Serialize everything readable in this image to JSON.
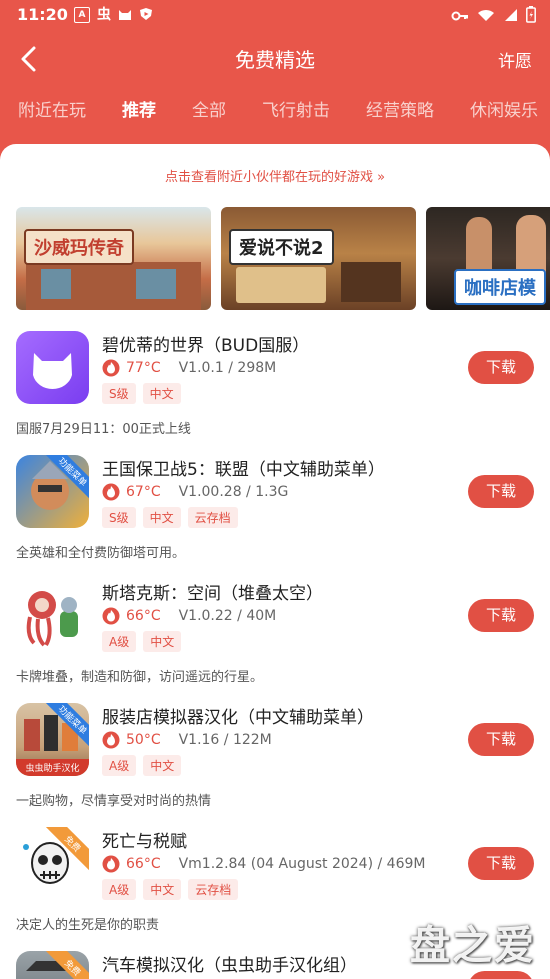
{
  "status": {
    "time": "11:20",
    "icons": [
      "A",
      "虫",
      "🐱",
      "▶"
    ],
    "right_icons": [
      "key-icon",
      "wifi-icon",
      "signal-icon",
      "battery-icon"
    ]
  },
  "header": {
    "title": "免费精选",
    "right_action": "许愿"
  },
  "tabs": [
    {
      "label": "附近在玩",
      "active": false
    },
    {
      "label": "推荐",
      "active": true
    },
    {
      "label": "全部",
      "active": false
    },
    {
      "label": "飞行射击",
      "active": false
    },
    {
      "label": "经营策略",
      "active": false
    },
    {
      "label": "休闲娱乐",
      "active": false
    }
  ],
  "notice": "点击查看附近小伙伴都在玩的好游戏 »",
  "banners": [
    {
      "label": "沙威玛传奇"
    },
    {
      "label": "爱说不说2"
    },
    {
      "label": "咖啡店模"
    }
  ],
  "download_label": "下载",
  "games": [
    {
      "name": "碧优蒂的世界（BUD国服）",
      "temp": "77°C",
      "version": "V1.0.1 / 298M",
      "tags": [
        "S级",
        "中文"
      ],
      "desc": "国服7月29日11：00正式上线",
      "corner": ""
    },
    {
      "name": "王国保卫战5：联盟（中文辅助菜单）",
      "temp": "67°C",
      "version": "V1.00.28 / 1.3G",
      "tags": [
        "S级",
        "中文",
        "云存档"
      ],
      "desc": "全英雄和全付费防御塔可用。",
      "corner": "功能菜单"
    },
    {
      "name": "斯塔克斯：空间（堆叠太空）",
      "temp": "66°C",
      "version": "V1.0.22 / 40M",
      "tags": [
        "A级",
        "中文"
      ],
      "desc": "卡牌堆叠，制造和防御，访问遥远的行星。",
      "corner": ""
    },
    {
      "name": "服装店模拟器汉化（中文辅助菜单）",
      "temp": "50°C",
      "version": "V1.16 / 122M",
      "tags": [
        "A级",
        "中文"
      ],
      "desc": "一起购物，尽情享受对时尚的热情",
      "corner": "功能菜单",
      "icon_caption": "虫虫助手汉化"
    },
    {
      "name": "死亡与税赋",
      "temp": "66°C",
      "version": "Vm1.2.84 (04 August 2024) / 469M",
      "tags": [
        "A级",
        "中文",
        "云存档"
      ],
      "desc": "决定人的生死是你的职责",
      "corner": "免费"
    },
    {
      "name": "汽车模拟汉化（虫虫助手汉化组）",
      "temp": "",
      "version": "",
      "tags": [],
      "desc": "",
      "corner": "免费"
    }
  ],
  "watermark": "盘之爱",
  "colors": {
    "accent": "#e8564a",
    "primary_red": "#e15044",
    "tag_bg": "#fcebe9"
  }
}
